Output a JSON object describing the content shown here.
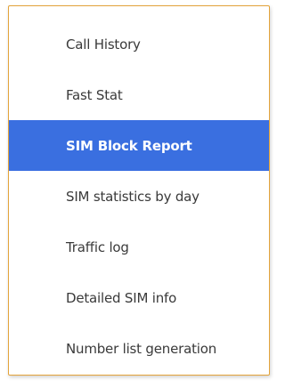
{
  "menu": {
    "items": [
      {
        "label": "Call History",
        "selected": false
      },
      {
        "label": "Fast Stat",
        "selected": false
      },
      {
        "label": "SIM Block Report",
        "selected": true
      },
      {
        "label": "SIM statistics by day",
        "selected": false
      },
      {
        "label": "Traffic log",
        "selected": false
      },
      {
        "label": "Detailed SIM info",
        "selected": false
      },
      {
        "label": "Number list generation",
        "selected": false
      }
    ],
    "colors": {
      "selected_background": "#3a6fe0",
      "selected_text": "#ffffff",
      "text": "#3a3a3a",
      "border": "#e3a33a"
    }
  }
}
